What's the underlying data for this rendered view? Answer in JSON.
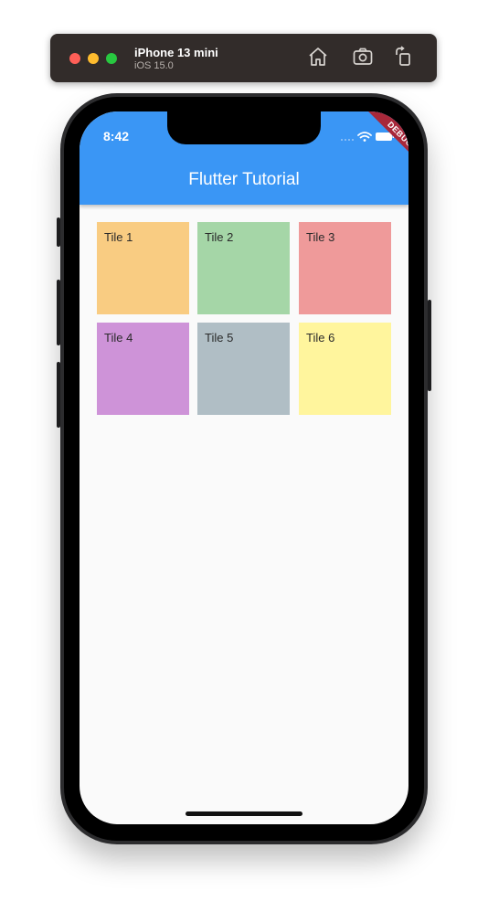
{
  "simulator": {
    "device_name": "iPhone 13 mini",
    "os_version": "iOS 15.0",
    "toolbar_icons": [
      "home-icon",
      "screenshot-icon",
      "rotate-icon"
    ]
  },
  "status_bar": {
    "time": "8:42",
    "icons": [
      "signal-icon",
      "wifi-icon",
      "battery-icon"
    ]
  },
  "app_bar": {
    "title": "Flutter Tutorial",
    "color": "#3a96f5"
  },
  "debug_banner": {
    "label": "DEBUG"
  },
  "grid": {
    "tiles": [
      {
        "label": "Tile 1",
        "color": "#f9cc82"
      },
      {
        "label": "Tile 2",
        "color": "#a5d6a7"
      },
      {
        "label": "Tile 3",
        "color": "#ef9a9a"
      },
      {
        "label": "Tile 4",
        "color": "#ce93d8"
      },
      {
        "label": "Tile 5",
        "color": "#b0bec5"
      },
      {
        "label": "Tile 6",
        "color": "#fff59d"
      }
    ]
  }
}
